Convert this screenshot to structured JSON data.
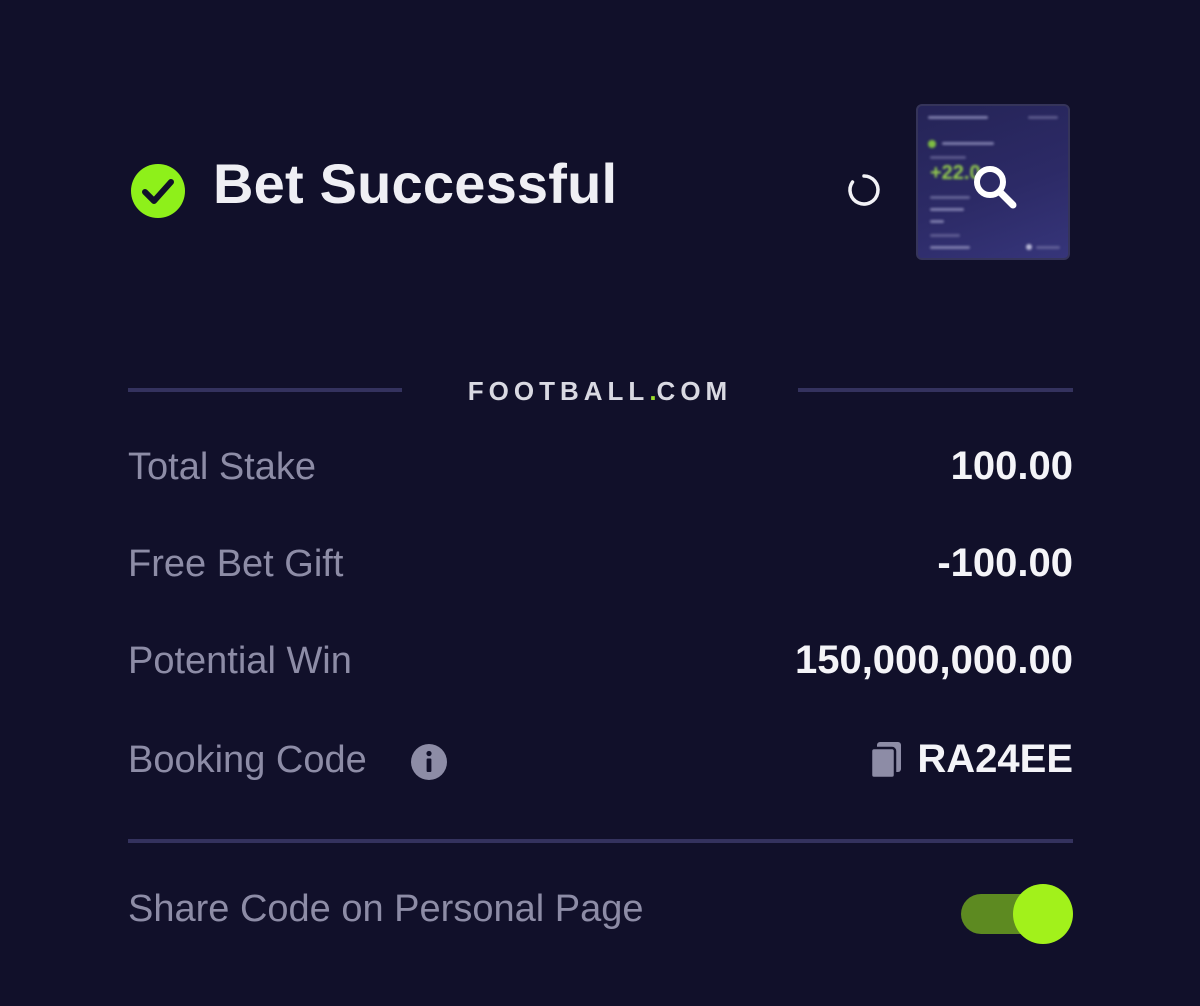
{
  "header": {
    "title": "Bet Successful"
  },
  "brand": {
    "name_part1": "FOOTBALL",
    "name_dot": ".",
    "name_part2": "COM"
  },
  "summary": {
    "rows": [
      {
        "label": "Total Stake",
        "value": "100.00"
      },
      {
        "label": "Free Bet Gift",
        "value": "-100.00"
      },
      {
        "label": "Potential Win",
        "value": "150,000,000.00"
      },
      {
        "label": "Booking Code",
        "value": "RA24EE"
      }
    ]
  },
  "share": {
    "label": "Share Code on Personal Page",
    "enabled": true
  },
  "thumbnail": {
    "preview_amount": "+22.0"
  },
  "icons": {
    "success": "check-circle-icon",
    "loading": "loading-spinner-icon",
    "zoom": "search-icon",
    "info": "info-icon",
    "copy": "copy-icon"
  },
  "colors": {
    "background": "#11102a",
    "accent_green": "#a2f11b",
    "divider": "#34325e",
    "label_gray": "#8d8ca6"
  }
}
